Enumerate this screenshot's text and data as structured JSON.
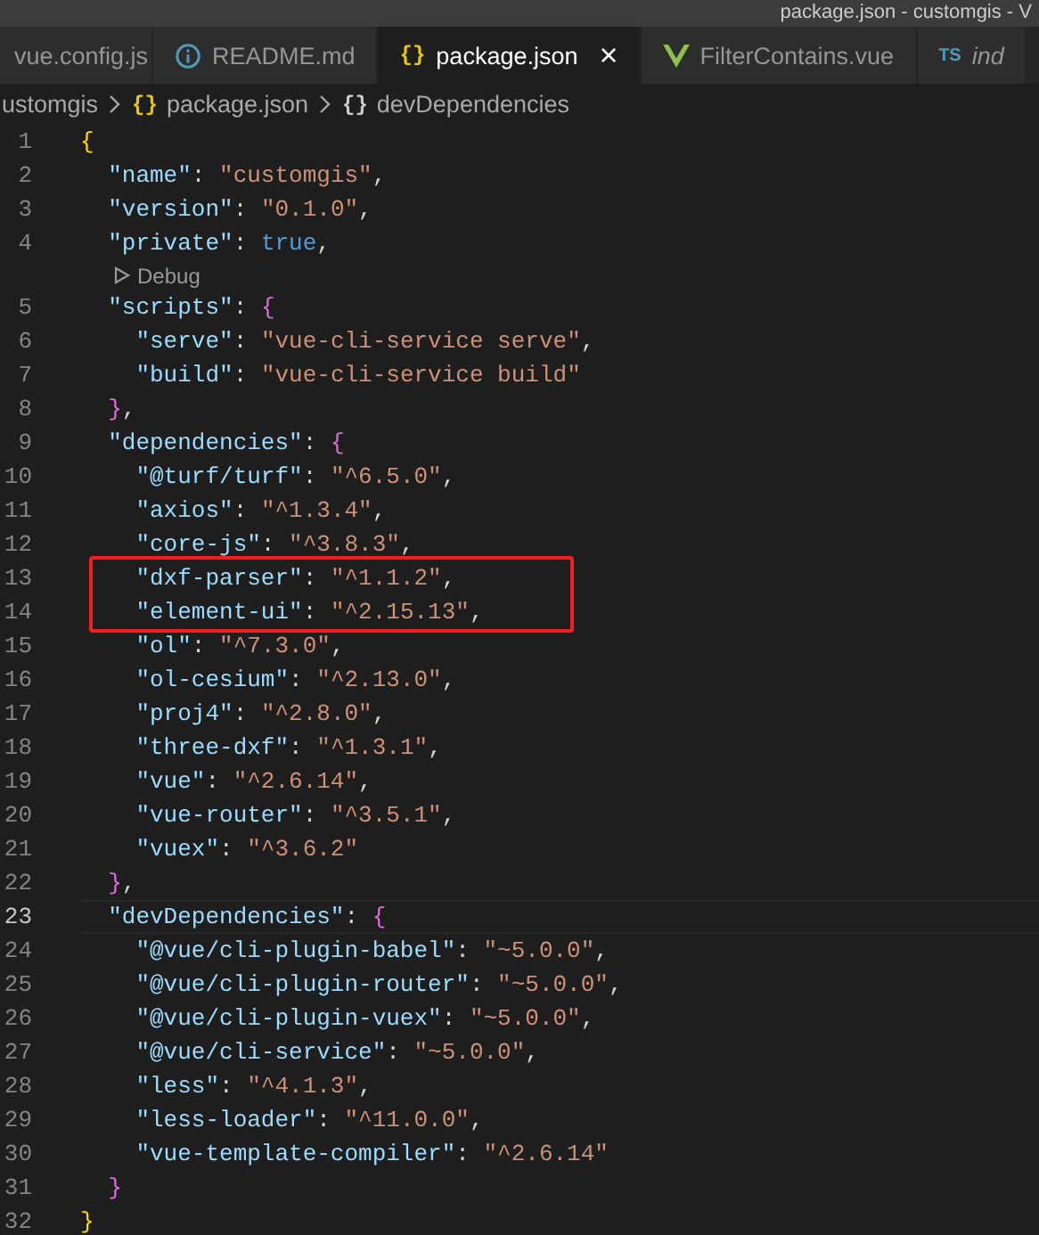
{
  "window": {
    "title": "package.json - customgis - V"
  },
  "tabs": [
    {
      "label": "vue.config.js",
      "kind": "plain",
      "selected": false,
      "preview": false
    },
    {
      "label": "README.md",
      "kind": "info",
      "selected": false,
      "preview": false
    },
    {
      "label": "package.json",
      "kind": "json",
      "icon_text": "{}",
      "selected": true,
      "preview": false,
      "close": "×"
    },
    {
      "label": "FilterContains.vue",
      "kind": "vue",
      "selected": false,
      "preview": false
    },
    {
      "label": "ind",
      "kind": "ts",
      "icon_text": "TS",
      "selected": false,
      "preview": true
    }
  ],
  "breadcrumb": [
    {
      "label": "ustomgis",
      "kind": "folder"
    },
    {
      "label": "package.json",
      "kind": "file",
      "icon_text": "{}"
    },
    {
      "label": "devDependencies",
      "kind": "symbol",
      "icon_text": "{}"
    }
  ],
  "editor": {
    "lines": [
      {
        "kind": "code",
        "number": "1",
        "current": false,
        "boxed": false,
        "tokens": [
          {
            "kind": "brace1",
            "text": "{"
          }
        ]
      },
      {
        "kind": "code",
        "number": "2",
        "current": false,
        "boxed": false,
        "tokens": [
          {
            "kind": "key",
            "text": "  \"name\""
          },
          {
            "kind": "punct",
            "text": ": "
          },
          {
            "kind": "string",
            "text": "\"customgis\""
          },
          {
            "kind": "punct",
            "text": ","
          }
        ]
      },
      {
        "kind": "code",
        "number": "3",
        "current": false,
        "boxed": false,
        "tokens": [
          {
            "kind": "key",
            "text": "  \"version\""
          },
          {
            "kind": "punct",
            "text": ": "
          },
          {
            "kind": "string",
            "text": "\"0.1.0\""
          },
          {
            "kind": "punct",
            "text": ","
          }
        ]
      },
      {
        "kind": "code",
        "number": "4",
        "current": false,
        "boxed": false,
        "tokens": [
          {
            "kind": "key",
            "text": "  \"private\""
          },
          {
            "kind": "punct",
            "text": ": "
          },
          {
            "kind": "bool",
            "text": "true"
          },
          {
            "kind": "punct",
            "text": ","
          }
        ]
      },
      {
        "kind": "codelens",
        "text": "Debug"
      },
      {
        "kind": "code",
        "number": "5",
        "current": false,
        "boxed": false,
        "tokens": [
          {
            "kind": "key",
            "text": "  \"scripts\""
          },
          {
            "kind": "punct",
            "text": ": "
          },
          {
            "kind": "brace2",
            "text": "{"
          }
        ]
      },
      {
        "kind": "code",
        "number": "6",
        "current": false,
        "boxed": false,
        "tokens": [
          {
            "kind": "key",
            "text": "    \"serve\""
          },
          {
            "kind": "punct",
            "text": ": "
          },
          {
            "kind": "string",
            "text": "\"vue-cli-service serve\""
          },
          {
            "kind": "punct",
            "text": ","
          }
        ]
      },
      {
        "kind": "code",
        "number": "7",
        "current": false,
        "boxed": false,
        "tokens": [
          {
            "kind": "key",
            "text": "    \"build\""
          },
          {
            "kind": "punct",
            "text": ": "
          },
          {
            "kind": "string",
            "text": "\"vue-cli-service build\""
          }
        ]
      },
      {
        "kind": "code",
        "number": "8",
        "current": false,
        "boxed": false,
        "tokens": [
          {
            "kind": "brace2",
            "text": "  }"
          },
          {
            "kind": "punct",
            "text": ","
          }
        ]
      },
      {
        "kind": "code",
        "number": "9",
        "current": false,
        "boxed": false,
        "tokens": [
          {
            "kind": "key",
            "text": "  \"dependencies\""
          },
          {
            "kind": "punct",
            "text": ": "
          },
          {
            "kind": "brace2",
            "text": "{"
          }
        ]
      },
      {
        "kind": "code",
        "number": "10",
        "current": false,
        "boxed": false,
        "tokens": [
          {
            "kind": "key",
            "text": "    \"@turf/turf\""
          },
          {
            "kind": "punct",
            "text": ": "
          },
          {
            "kind": "string",
            "text": "\"^6.5.0\""
          },
          {
            "kind": "punct",
            "text": ","
          }
        ]
      },
      {
        "kind": "code",
        "number": "11",
        "current": false,
        "boxed": false,
        "tokens": [
          {
            "kind": "key",
            "text": "    \"axios\""
          },
          {
            "kind": "punct",
            "text": ": "
          },
          {
            "kind": "string",
            "text": "\"^1.3.4\""
          },
          {
            "kind": "punct",
            "text": ","
          }
        ]
      },
      {
        "kind": "code",
        "number": "12",
        "current": false,
        "boxed": false,
        "tokens": [
          {
            "kind": "key",
            "text": "    \"core-js\""
          },
          {
            "kind": "punct",
            "text": ": "
          },
          {
            "kind": "string",
            "text": "\"^3.8.3\""
          },
          {
            "kind": "punct",
            "text": ","
          }
        ]
      },
      {
        "kind": "code",
        "number": "13",
        "current": false,
        "boxed": true,
        "tokens": [
          {
            "kind": "key",
            "text": "    \"dxf-parser\""
          },
          {
            "kind": "punct",
            "text": ": "
          },
          {
            "kind": "string",
            "text": "\"^1.1.2\""
          },
          {
            "kind": "punct",
            "text": ","
          }
        ]
      },
      {
        "kind": "code",
        "number": "14",
        "current": false,
        "boxed": true,
        "tokens": [
          {
            "kind": "key",
            "text": "    \"element-ui\""
          },
          {
            "kind": "punct",
            "text": ": "
          },
          {
            "kind": "string",
            "text": "\"^2.15.13\""
          },
          {
            "kind": "punct",
            "text": ","
          }
        ]
      },
      {
        "kind": "code",
        "number": "15",
        "current": false,
        "boxed": false,
        "tokens": [
          {
            "kind": "key",
            "text": "    \"ol\""
          },
          {
            "kind": "punct",
            "text": ": "
          },
          {
            "kind": "string",
            "text": "\"^7.3.0\""
          },
          {
            "kind": "punct",
            "text": ","
          }
        ]
      },
      {
        "kind": "code",
        "number": "16",
        "current": false,
        "boxed": false,
        "tokens": [
          {
            "kind": "key",
            "text": "    \"ol-cesium\""
          },
          {
            "kind": "punct",
            "text": ": "
          },
          {
            "kind": "string",
            "text": "\"^2.13.0\""
          },
          {
            "kind": "punct",
            "text": ","
          }
        ]
      },
      {
        "kind": "code",
        "number": "17",
        "current": false,
        "boxed": false,
        "tokens": [
          {
            "kind": "key",
            "text": "    \"proj4\""
          },
          {
            "kind": "punct",
            "text": ": "
          },
          {
            "kind": "string",
            "text": "\"^2.8.0\""
          },
          {
            "kind": "punct",
            "text": ","
          }
        ]
      },
      {
        "kind": "code",
        "number": "18",
        "current": false,
        "boxed": false,
        "tokens": [
          {
            "kind": "key",
            "text": "    \"three-dxf\""
          },
          {
            "kind": "punct",
            "text": ": "
          },
          {
            "kind": "string",
            "text": "\"^1.3.1\""
          },
          {
            "kind": "punct",
            "text": ","
          }
        ]
      },
      {
        "kind": "code",
        "number": "19",
        "current": false,
        "boxed": false,
        "tokens": [
          {
            "kind": "key",
            "text": "    \"vue\""
          },
          {
            "kind": "punct",
            "text": ": "
          },
          {
            "kind": "string",
            "text": "\"^2.6.14\""
          },
          {
            "kind": "punct",
            "text": ","
          }
        ]
      },
      {
        "kind": "code",
        "number": "20",
        "current": false,
        "boxed": false,
        "tokens": [
          {
            "kind": "key",
            "text": "    \"vue-router\""
          },
          {
            "kind": "punct",
            "text": ": "
          },
          {
            "kind": "string",
            "text": "\"^3.5.1\""
          },
          {
            "kind": "punct",
            "text": ","
          }
        ]
      },
      {
        "kind": "code",
        "number": "21",
        "current": false,
        "boxed": false,
        "tokens": [
          {
            "kind": "key",
            "text": "    \"vuex\""
          },
          {
            "kind": "punct",
            "text": ": "
          },
          {
            "kind": "string",
            "text": "\"^3.6.2\""
          }
        ]
      },
      {
        "kind": "code",
        "number": "22",
        "current": false,
        "boxed": false,
        "tokens": [
          {
            "kind": "brace2",
            "text": "  }"
          },
          {
            "kind": "punct",
            "text": ","
          }
        ]
      },
      {
        "kind": "code",
        "number": "23",
        "current": true,
        "boxed": false,
        "tokens": [
          {
            "kind": "key",
            "text": "  \"devDependencies\""
          },
          {
            "kind": "punct",
            "text": ": "
          },
          {
            "kind": "brace2",
            "text": "{"
          }
        ]
      },
      {
        "kind": "code",
        "number": "24",
        "current": false,
        "boxed": false,
        "tokens": [
          {
            "kind": "key",
            "text": "    \"@vue/cli-plugin-babel\""
          },
          {
            "kind": "punct",
            "text": ": "
          },
          {
            "kind": "string",
            "text": "\"~5.0.0\""
          },
          {
            "kind": "punct",
            "text": ","
          }
        ]
      },
      {
        "kind": "code",
        "number": "25",
        "current": false,
        "boxed": false,
        "tokens": [
          {
            "kind": "key",
            "text": "    \"@vue/cli-plugin-router\""
          },
          {
            "kind": "punct",
            "text": ": "
          },
          {
            "kind": "string",
            "text": "\"~5.0.0\""
          },
          {
            "kind": "punct",
            "text": ","
          }
        ]
      },
      {
        "kind": "code",
        "number": "26",
        "current": false,
        "boxed": false,
        "tokens": [
          {
            "kind": "key",
            "text": "    \"@vue/cli-plugin-vuex\""
          },
          {
            "kind": "punct",
            "text": ": "
          },
          {
            "kind": "string",
            "text": "\"~5.0.0\""
          },
          {
            "kind": "punct",
            "text": ","
          }
        ]
      },
      {
        "kind": "code",
        "number": "27",
        "current": false,
        "boxed": false,
        "tokens": [
          {
            "kind": "key",
            "text": "    \"@vue/cli-service\""
          },
          {
            "kind": "punct",
            "text": ": "
          },
          {
            "kind": "string",
            "text": "\"~5.0.0\""
          },
          {
            "kind": "punct",
            "text": ","
          }
        ]
      },
      {
        "kind": "code",
        "number": "28",
        "current": false,
        "boxed": false,
        "tokens": [
          {
            "kind": "key",
            "text": "    \"less\""
          },
          {
            "kind": "punct",
            "text": ": "
          },
          {
            "kind": "string",
            "text": "\"^4.1.3\""
          },
          {
            "kind": "punct",
            "text": ","
          }
        ]
      },
      {
        "kind": "code",
        "number": "29",
        "current": false,
        "boxed": false,
        "tokens": [
          {
            "kind": "key",
            "text": "    \"less-loader\""
          },
          {
            "kind": "punct",
            "text": ": "
          },
          {
            "kind": "string",
            "text": "\"^11.0.0\""
          },
          {
            "kind": "punct",
            "text": ","
          }
        ]
      },
      {
        "kind": "code",
        "number": "30",
        "current": false,
        "boxed": false,
        "tokens": [
          {
            "kind": "key",
            "text": "    \"vue-template-compiler\""
          },
          {
            "kind": "punct",
            "text": ": "
          },
          {
            "kind": "string",
            "text": "\"^2.6.14\""
          }
        ]
      },
      {
        "kind": "code",
        "number": "31",
        "current": false,
        "boxed": false,
        "tokens": [
          {
            "kind": "brace2",
            "text": "  }"
          }
        ]
      },
      {
        "kind": "code",
        "number": "32",
        "current": false,
        "boxed": false,
        "tokens": [
          {
            "kind": "brace1",
            "text": "}"
          }
        ]
      }
    ]
  }
}
